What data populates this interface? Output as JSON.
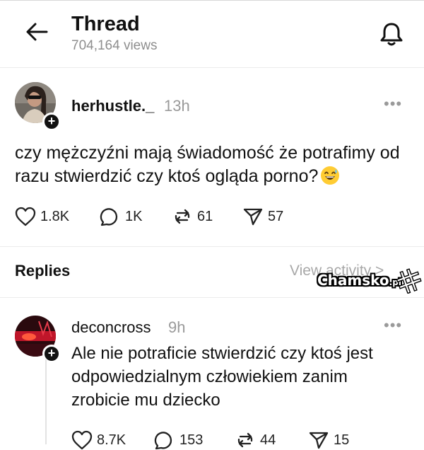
{
  "header": {
    "title": "Thread",
    "views": "704,164 views"
  },
  "post": {
    "username": "herhustle._",
    "time": "13h",
    "text": "czy mężczyźni mają świadomość że potrafimy od razu stwierdzić czy ktoś ogląda porno?",
    "stats": {
      "likes": "1.8K",
      "comments": "1K",
      "reposts": "61",
      "shares": "57"
    }
  },
  "replies_section": {
    "label": "Replies",
    "view_activity": "View activity >"
  },
  "watermark": {
    "brand": "Chamsko",
    "suffix": ".pl"
  },
  "reply": {
    "username": "deconcross",
    "time": "9h",
    "text": "Ale nie potraficie stwierdzić czy ktoś jest odpowiedzialnym człowiekiem zanim zrobicie mu dziecko",
    "stats": {
      "likes": "8.7K",
      "comments": "153",
      "reposts": "44",
      "shares": "15"
    }
  }
}
